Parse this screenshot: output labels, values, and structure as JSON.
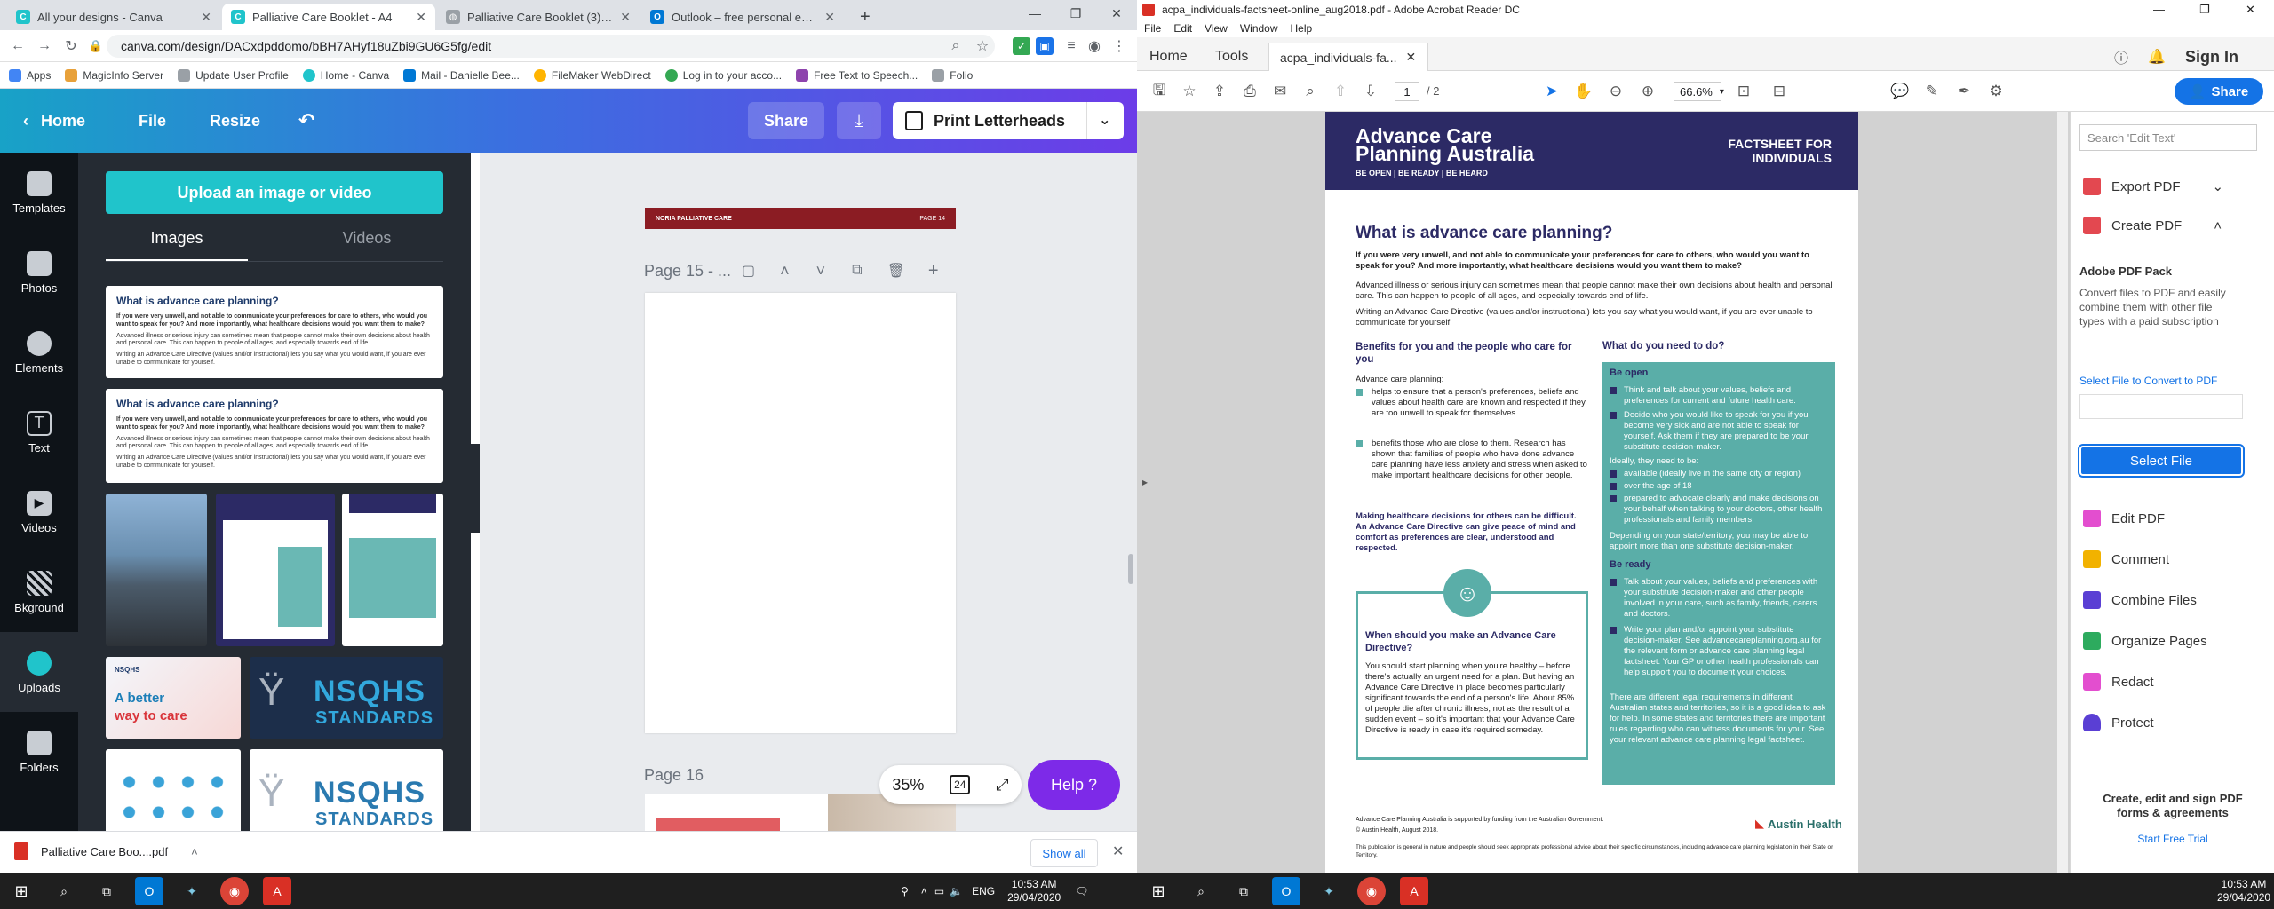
{
  "chrome": {
    "tabs": [
      {
        "title": "All your designs - Canva",
        "icon": "canva-icon",
        "color": "#20c4cb"
      },
      {
        "title": "Palliative Care Booklet - A4",
        "icon": "canva-icon",
        "color": "#20c4cb"
      },
      {
        "title": "Palliative Care Booklet (3).pdf",
        "icon": "globe-icon",
        "color": "#5f6368"
      },
      {
        "title": "Outlook – free personal email an",
        "icon": "outlook-icon",
        "color": "#0078d4"
      }
    ],
    "url": "canva.com/design/DACxdpddomo/bBH7AHyf18uZbi9GU6G5fg/edit",
    "bookmarks": [
      {
        "label": "Apps",
        "color": "#4285f4"
      },
      {
        "label": "MagicInfo Server",
        "color": "#e8a13a"
      },
      {
        "label": "Update User Profile",
        "color": "#5f6368"
      },
      {
        "label": "Home - Canva",
        "color": "#20c4cb"
      },
      {
        "label": "Mail - Danielle Bee...",
        "color": "#0078d4"
      },
      {
        "label": "FileMaker WebDirect",
        "color": "#ffb400"
      },
      {
        "label": "Log in to your acco...",
        "color": "#34a853"
      },
      {
        "label": "Free Text to Speech...",
        "color": "#8e44ad"
      },
      {
        "label": "Folio",
        "color": "#5f6368"
      }
    ]
  },
  "canva": {
    "nav": {
      "home": "Home",
      "file": "File",
      "resize": "Resize",
      "share": "Share",
      "print": "Print Letterheads"
    },
    "sidebar": [
      "Templates",
      "Photos",
      "Elements",
      "Text",
      "Videos",
      "Bkground",
      "Uploads",
      "Folders"
    ],
    "upload_button": "Upload an image or video",
    "panel_tabs": [
      "Images",
      "Videos"
    ],
    "thumb_doc": {
      "title": "What is advance care planning?",
      "p1": "If you were very unwell, and not able to communicate your preferences for care to others, who would you want to speak for you? And more importantly, what healthcare decisions would you want them to make?",
      "p2": "Advanced illness or serious injury can sometimes mean that people cannot make their own decisions about health and personal care. This can happen to people of all ages, and especially towards end of life.",
      "p3": "Writing an Advance Care Directive (values and/or instructional) lets you say what you would want, if you are ever unable to communicate for yourself."
    },
    "nsqhs": {
      "a_better": "A better",
      "way_to_care": "way to care",
      "nsqhs": "NSQHS",
      "standards": "STANDARDS"
    },
    "page_top_footer": {
      "left": "NORIA PALLIATIVE CARE",
      "right": "PAGE 14"
    },
    "page15_label": "Page 15 - ...",
    "page16_label": "Page 16",
    "zoom": "35%",
    "pages_badge": "24",
    "help": "Help ?",
    "download_bar": {
      "file": "Palliative Care Boo....pdf",
      "show_all": "Show all"
    }
  },
  "acrobat": {
    "title": "acpa_individuals-factsheet-online_aug2018.pdf - Adobe Acrobat Reader DC",
    "menu": [
      "File",
      "Edit",
      "View",
      "Window",
      "Help"
    ],
    "tabs": {
      "home": "Home",
      "tools": "Tools",
      "doc": "acpa_individuals-fa...",
      "signin": "Sign In"
    },
    "toolbar": {
      "page": "1",
      "total": "/ 2",
      "zoom": "66.6%",
      "share": "Share"
    },
    "right_panel": {
      "search_placeholder": "Search 'Edit Text'",
      "export": "Export PDF",
      "create": "Create PDF",
      "pack_title": "Adobe PDF Pack",
      "pack_desc": "Convert files to PDF and easily combine them with other file types with a paid subscription",
      "select_label": "Select File to Convert to PDF",
      "select_button": "Select File",
      "tools": [
        "Edit PDF",
        "Comment",
        "Combine Files",
        "Organize Pages",
        "Redact",
        "Protect"
      ],
      "promo1": "Create, edit and sign PDF",
      "promo2": "forms & agreements",
      "trial": "Start Free Trial"
    },
    "pdf": {
      "brand1": "Advance Care",
      "brand2": "Planning Australia",
      "tagline": "BE OPEN | BE READY | BE HEARD",
      "factsheet1": "FACTSHEET FOR",
      "factsheet2": "INDIVIDUALS",
      "heading": "What is advance care planning?",
      "intro_bold": "If you were very unwell, and not able to communicate your preferences for care to others, who would you want to speak for you? And more importantly, what healthcare decisions would you want them to make?",
      "intro1": "Advanced illness or serious injury can sometimes mean that people cannot make their own decisions about health and personal care. This can happen to people of all ages, and especially towards end of life.",
      "intro2": "Writing an Advance Care Directive (values and/or instructional) lets you say what you would want, if you are ever unable to communicate for yourself.",
      "benefits_h": "Benefits for you and the people who care for you",
      "benefits_lead": "Advance care planning:",
      "benefit1": "helps to ensure that a person's preferences, beliefs and values about health care are known and respected if they are too unwell to speak for themselves",
      "benefit2": "benefits those who are close to them. Research has shown that families of people who have done advance care planning have less anxiety and stress when asked to make important healthcare decisions for other people.",
      "making": "Making healthcare decisions for others can be difficult. An Advance Care Directive can give peace of mind and comfort as preferences are clear, understood and respected.",
      "when_h": "When should you make an Advance Care Directive?",
      "when_p": "You should start planning when you're healthy – before there's actually an urgent need for a plan. But having an Advance Care Directive in place becomes particularly significant towards the end of a person's life. About 85% of people die after chronic illness, not as the result of a sudden event – so it's important that your Advance Care Directive is ready in case it's required someday.",
      "need_h": "What do you need to do?",
      "be_open": "Be open",
      "open1": "Think and talk about your values, beliefs and preferences for current and future health care.",
      "open2": "Decide who you would like to speak for you if you become very sick and are not able to speak for yourself. Ask them if they are prepared to be your substitute decision-maker.",
      "ideally": "Ideally, they need to be:",
      "ideal1": "available (ideally live in the same city or region)",
      "ideal2": "over the age of 18",
      "ideal3": "prepared to advocate clearly and make decisions on your behalf when talking to your doctors, other health professionals and family members.",
      "depending": "Depending on your state/territory, you may be able to appoint more than one substitute decision-maker.",
      "be_ready": "Be ready",
      "ready1": "Talk about your values, beliefs and preferences with your substitute decision-maker and other people involved in your care, such as family, friends, carers and doctors.",
      "ready2": "Write your plan and/or appoint your substitute decision-maker. See advancecareplanning.org.au for the relevant form or advance care planning legal factsheet. Your GP or other health professionals can help support you to document your choices.",
      "legal": "There are different legal requirements in different Australian states and territories, so it is a good idea to ask for help. In some states and territories there are important rules regarding who can witness documents for your. See your relevant advance care planning legal factsheet.",
      "footer1": "Advance Care Planning Australia is supported by funding from the Australian Government.",
      "footer2": "© Austin Health, August 2018.",
      "footer3": "This publication is general in nature and people should seek appropriate professional advice about their specific circumstances, including advance care planning legislation in their State or Territory.",
      "austin": "Austin Health"
    }
  },
  "taskbar": {
    "left": {
      "lang": "ENG",
      "time": "10:53 AM",
      "date": "29/04/2020"
    },
    "right": {
      "time": "10:53 AM",
      "date": "29/04/2020"
    }
  }
}
